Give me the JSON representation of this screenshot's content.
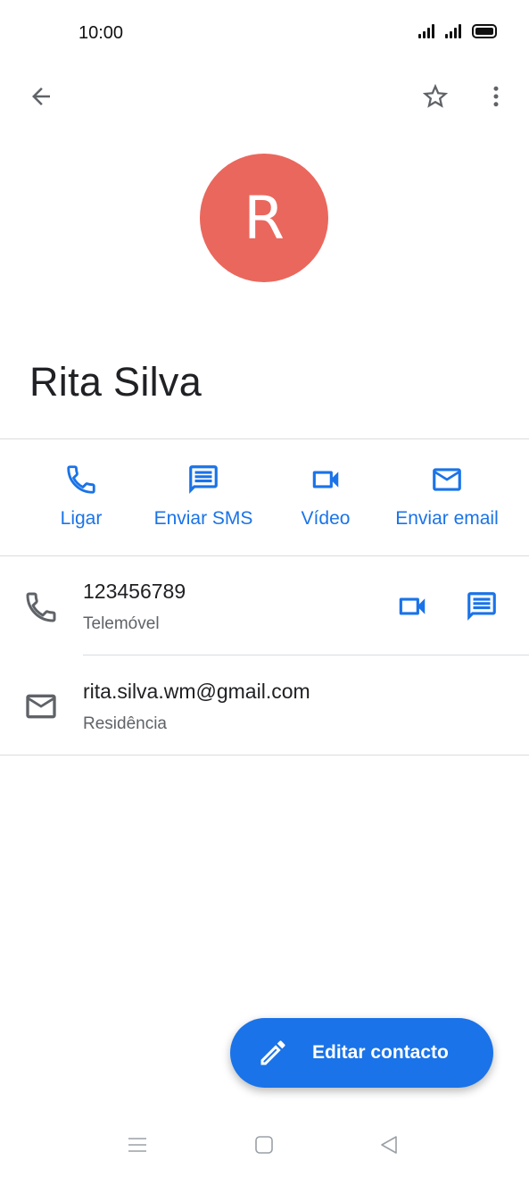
{
  "status_bar": {
    "time": "10:00",
    "icons": [
      "signal-icon",
      "signal-icon",
      "battery-icon"
    ]
  },
  "top_bar": {
    "back_icon": "arrow-left-icon",
    "favorite_icon": "star-outline-icon",
    "more_icon": "more-vertical-icon"
  },
  "contact": {
    "avatar_letter": "R",
    "avatar_color": "#ea675d",
    "name": "Rita Silva"
  },
  "actions": [
    {
      "label": "Ligar",
      "icon": "phone-icon"
    },
    {
      "label": "Enviar SMS",
      "icon": "message-icon"
    },
    {
      "label": "Vídeo",
      "icon": "video-icon"
    },
    {
      "label": "Enviar email",
      "icon": "email-icon"
    }
  ],
  "details": {
    "phone": {
      "number": "123456789",
      "type": "Telemóvel"
    },
    "email": {
      "address": "rita.silva.wm@gmail.com",
      "type": "Residência"
    }
  },
  "fab": {
    "label": "Editar contacto",
    "icon": "pencil-icon"
  },
  "nav_bar": {
    "icons": [
      "menu-icon",
      "home-icon",
      "back-triangle-icon"
    ]
  },
  "colors": {
    "accent": "#1a73e8",
    "avatar": "#ea675d",
    "text_primary": "#202124",
    "text_secondary": "#5f6368",
    "divider": "#dadce0"
  }
}
